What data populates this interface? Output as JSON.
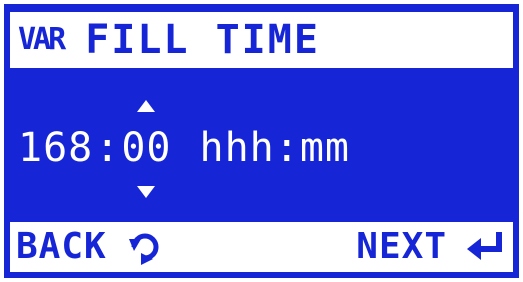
{
  "header": {
    "badge": "VAR",
    "title": "FILL TIME"
  },
  "value": {
    "hours": "168",
    "separator": ":",
    "minutes": "00",
    "unit": "hhh:mm"
  },
  "footer": {
    "back_label": "BACK",
    "next_label": "NEXT"
  },
  "icons": {
    "back": "undo-arrow-icon",
    "next": "enter-return-icon",
    "increment": "up-arrow-icon",
    "decrement": "down-arrow-icon"
  },
  "colors": {
    "screen_background": "#1626d6",
    "bar_background": "#ffffff",
    "text_on_screen": "#ffffff",
    "text_on_bar": "#1626d6"
  }
}
